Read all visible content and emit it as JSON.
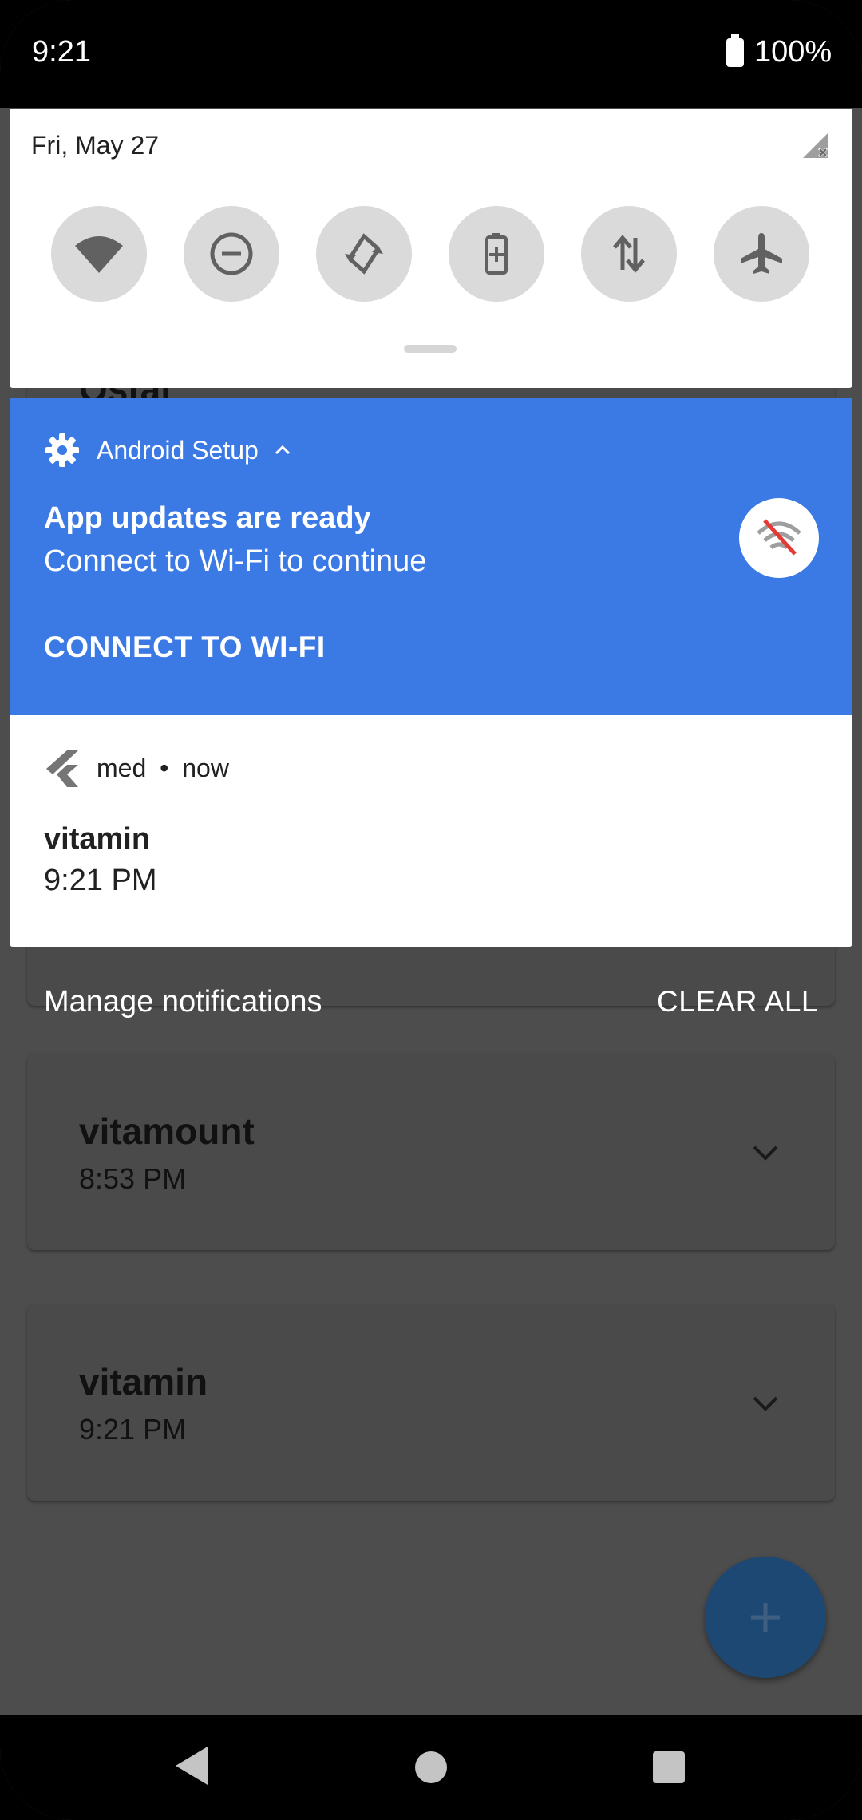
{
  "status_bar": {
    "time": "9:21",
    "battery": "100%"
  },
  "quick_settings": {
    "date": "Fri, May 27",
    "tiles": [
      {
        "icon": "wifi-icon"
      },
      {
        "icon": "do-not-disturb-icon"
      },
      {
        "icon": "auto-rotate-icon"
      },
      {
        "icon": "battery-saver-icon"
      },
      {
        "icon": "mobile-data-icon"
      },
      {
        "icon": "airplane-mode-icon"
      }
    ]
  },
  "notifications": [
    {
      "app": "Android Setup",
      "title": "App updates are ready",
      "text": "Connect to Wi-Fi to continue",
      "action": "CONNECT TO WI-FI",
      "color": "#3b7ae5"
    },
    {
      "app": "med",
      "separator": "•",
      "time": "now",
      "title": "vitamin",
      "text": "9:21 PM"
    }
  ],
  "footer": {
    "manage": "Manage notifications",
    "clear_all": "CLEAR ALL"
  },
  "background_app": {
    "partial_title": "Ostal",
    "cards": [
      {
        "title": "vitamount",
        "time": "8:53 PM"
      },
      {
        "title": "vitamin",
        "time": "9:21 PM"
      }
    ],
    "fab_color": "#1c4873"
  }
}
